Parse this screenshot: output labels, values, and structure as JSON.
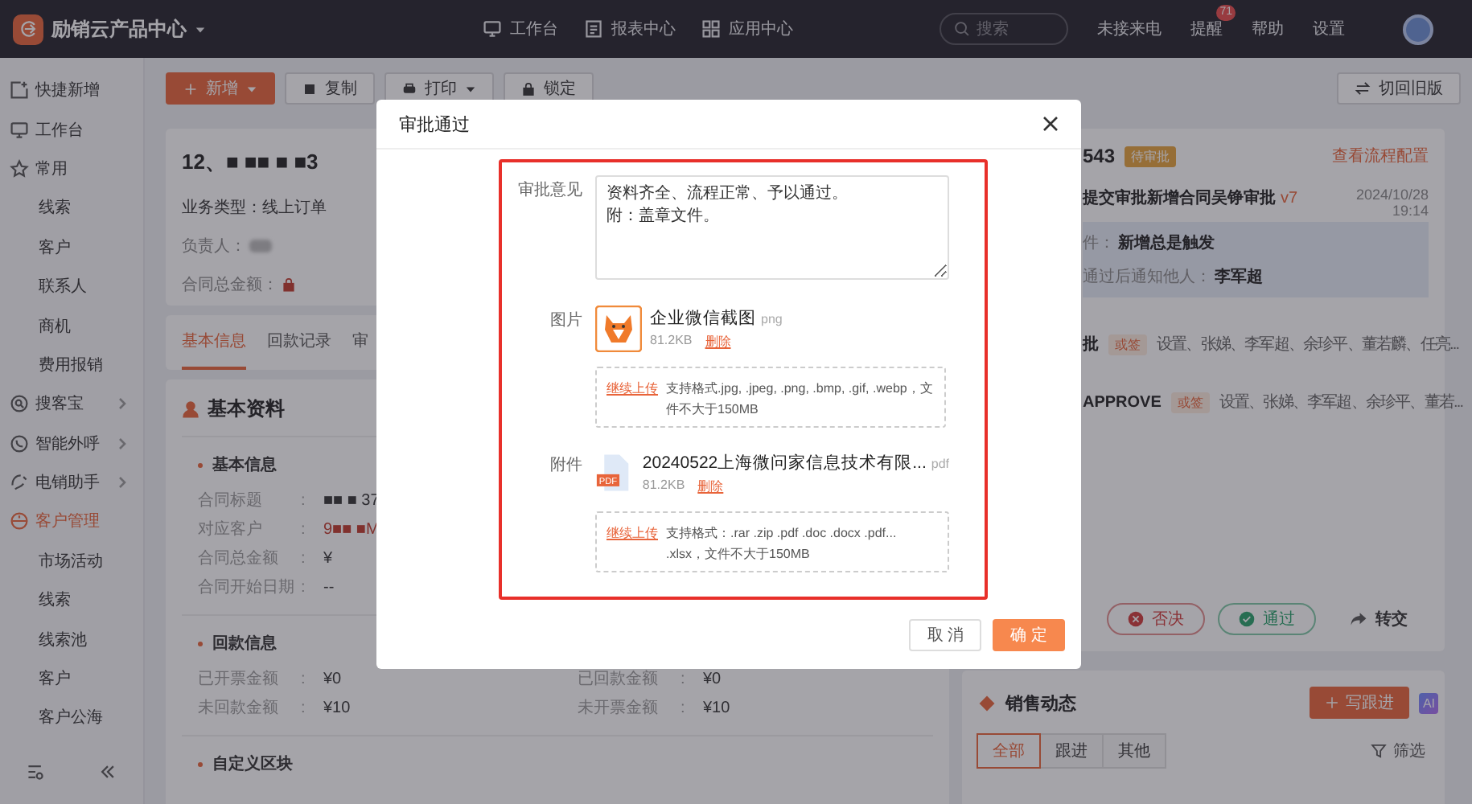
{
  "topbar": {
    "product": "励销云产品中心",
    "nav": [
      {
        "label": "工作台"
      },
      {
        "label": "报表中心"
      },
      {
        "label": "应用中心"
      }
    ],
    "search": {
      "placeholder": "搜索"
    },
    "links": [
      {
        "label": "未接来电"
      },
      {
        "label": "提醒",
        "badge": "71"
      },
      {
        "label": "帮助"
      },
      {
        "label": "设置"
      }
    ]
  },
  "sidebar": {
    "items": [
      {
        "label": "快捷新增",
        "selected": false
      },
      {
        "label": "工作台",
        "selected": false
      },
      {
        "label": "常用",
        "selected": false,
        "expanded": true,
        "children": [
          {
            "label": "线索",
            "selected": false
          },
          {
            "label": "客户",
            "selected": false
          },
          {
            "label": "联系人",
            "selected": false
          },
          {
            "label": "商机",
            "selected": false
          },
          {
            "label": "费用报销",
            "selected": false
          }
        ]
      },
      {
        "label": "搜客宝",
        "selected": false,
        "expanded": false
      },
      {
        "label": "智能外呼",
        "selected": false,
        "expanded": false
      },
      {
        "label": "电销助手",
        "selected": false,
        "expanded": false
      },
      {
        "label": "客户管理",
        "selected": true,
        "expanded": true,
        "children": [
          {
            "label": "市场活动",
            "selected": false
          },
          {
            "label": "线索",
            "selected": false
          },
          {
            "label": "线索池",
            "selected": false
          },
          {
            "label": "客户",
            "selected": false
          },
          {
            "label": "客户公海",
            "selected": false
          }
        ]
      }
    ]
  },
  "toolbar": {
    "buttons": [
      {
        "label": "新增",
        "kind": "primary",
        "dropdown": true
      },
      {
        "label": "复制",
        "kind": "default",
        "dropdown": false
      },
      {
        "label": "打印",
        "kind": "default",
        "dropdown": true
      },
      {
        "label": "锁定",
        "kind": "default",
        "dropdown": false
      }
    ],
    "switch_button": "切回旧版"
  },
  "record": {
    "title": "12、■ ■■  ■ ■3",
    "business_type": "业务类型：线上订单",
    "owner_label": "负责人：",
    "amount_label": "合同总金额："
  },
  "tabs": [
    {
      "label": "基本信息",
      "selected": true
    },
    {
      "label": "回款记录",
      "selected": false
    },
    {
      "label": "审",
      "selected": false
    }
  ],
  "details": {
    "title": "基本资料",
    "separator": ":",
    "groups": [
      {
        "title": "基本信息",
        "fields": [
          {
            "label": "合同标题",
            "value": "■■ ■ 37",
            "kind": "text"
          },
          {
            "label": "对应客户",
            "value": "9■■  ■M",
            "kind": "link"
          },
          {
            "label": "合同总金额",
            "value": "¥",
            "kind": "text"
          },
          {
            "label": "合同开始日期",
            "value": "--",
            "kind": "text"
          }
        ]
      },
      {
        "title": "回款信息",
        "columns": [
          [
            {
              "label": "已开票金额",
              "value": "¥0",
              "kind": "text"
            },
            {
              "label": "未回款金额",
              "value": "¥10",
              "kind": "text"
            }
          ],
          [
            {
              "label": "已回款金额",
              "value": "¥0",
              "kind": "text"
            },
            {
              "label": "未开票金额",
              "value": "¥10",
              "kind": "text"
            }
          ]
        ]
      },
      {
        "title": "自定义区块"
      }
    ]
  },
  "approval": {
    "number": "543",
    "status": "待审批",
    "config_link": "查看流程配置",
    "step": {
      "title": "提交审批新增合同吴铮审批",
      "version": "v7",
      "date": "2024/10/28",
      "time": "19:14"
    },
    "conditions": [
      {
        "label": "件：",
        "value": "新增总是触发"
      },
      {
        "label": "通过后通知他人：",
        "value": "李军超"
      }
    ],
    "nodes": [
      {
        "name": "批",
        "mode": "或签",
        "approvers": "设置、张娣、李军超、余珍平、董若麟、任亮..."
      },
      {
        "name": "APPROVE",
        "mode": "或签",
        "approvers": "设置、张娣、李军超、余珍平、董若..."
      }
    ],
    "actions": [
      {
        "label": "否决",
        "kind": "reject"
      },
      {
        "label": "通过",
        "kind": "approve"
      },
      {
        "label": "转交",
        "kind": "transfer"
      }
    ]
  },
  "sales": {
    "title": "销售动态",
    "add_button": "写跟进",
    "ai_badge": "AI",
    "tabs": [
      {
        "label": "全部",
        "selected": true
      },
      {
        "label": "跟进",
        "selected": false
      },
      {
        "label": "其他",
        "selected": false
      }
    ],
    "filter": "筛选"
  },
  "modal": {
    "title": "审批通过",
    "highlight": true,
    "fields": [
      {
        "label": "审批意见",
        "kind": "textarea",
        "lines": [
          "资料齐全、流程正常、予以通过。",
          "附：盖章文件。"
        ]
      },
      {
        "label": "图片",
        "kind": "upload",
        "file": {
          "kind": "image",
          "name": "企业微信截图",
          "ext": "png",
          "size": "81.2KB",
          "action": "删除"
        },
        "upload_link": "继续上传",
        "hint": "支持格式.jpg, .jpeg, .png, .bmp, .gif, .webp，文件不大于150MB"
      },
      {
        "label": "附件",
        "kind": "upload",
        "file": {
          "kind": "pdf",
          "icon_label": "PDF",
          "name": "20240522上海微问家信息技术有限...",
          "ext": "pdf",
          "size": "81.2KB",
          "action": "删除"
        },
        "upload_link": "继续上传",
        "hint": "支持格式：.rar .zip .pdf .doc .docx .pdf... .xlsx，文件不大于150MB"
      }
    ],
    "buttons": [
      {
        "label": "取 消",
        "kind": "default"
      },
      {
        "label": "确 定",
        "kind": "primary"
      }
    ]
  }
}
